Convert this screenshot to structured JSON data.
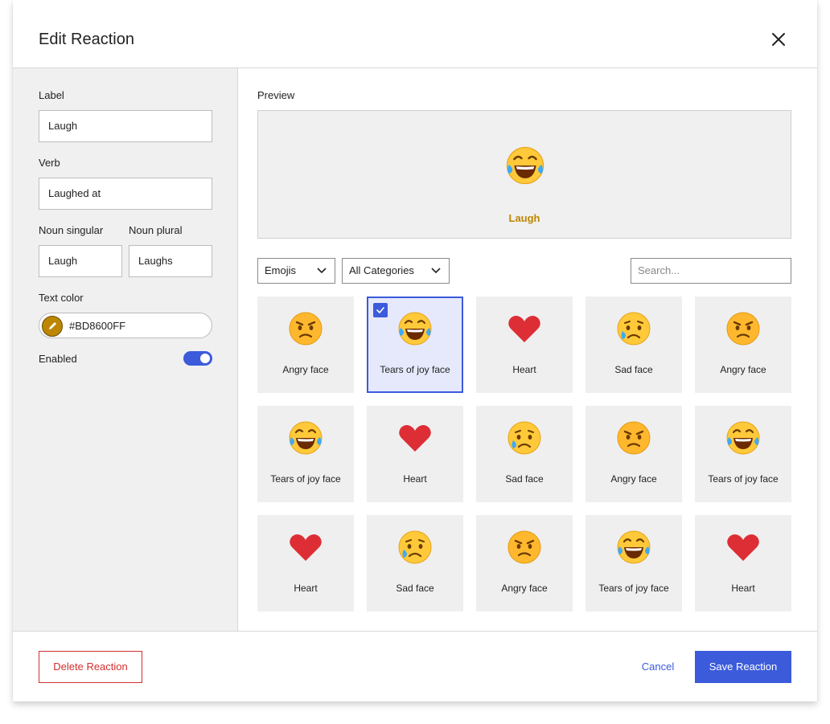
{
  "dialog": {
    "title": "Edit Reaction"
  },
  "form": {
    "label": {
      "label": "Label",
      "value": "Laugh"
    },
    "verb": {
      "label": "Verb",
      "value": "Laughed at"
    },
    "noun_singular": {
      "label": "Noun singular",
      "value": "Laugh"
    },
    "noun_plural": {
      "label": "Noun plural",
      "value": "Laughs"
    },
    "text_color": {
      "label": "Text color",
      "value": "#BD8600FF",
      "color": "#BD8600"
    },
    "enabled": {
      "label": "Enabled",
      "on": true
    }
  },
  "preview": {
    "heading": "Preview",
    "emoji": "tears-of-joy-emoji",
    "label": "Laugh",
    "label_color": "#BD8600"
  },
  "filters": {
    "type_select": "Emojis",
    "category_select": "All Categories",
    "search_placeholder": "Search..."
  },
  "grid": [
    {
      "label": "Angry face",
      "emoji": "angry",
      "selected": false
    },
    {
      "label": "Tears of joy face",
      "emoji": "joy",
      "selected": true
    },
    {
      "label": "Heart",
      "emoji": "heart",
      "selected": false
    },
    {
      "label": "Sad face",
      "emoji": "sad",
      "selected": false
    },
    {
      "label": "Angry face",
      "emoji": "angry",
      "selected": false
    },
    {
      "label": "Tears of joy face",
      "emoji": "joy",
      "selected": false
    },
    {
      "label": "Heart",
      "emoji": "heart",
      "selected": false
    },
    {
      "label": "Sad face",
      "emoji": "sad",
      "selected": false
    },
    {
      "label": "Angry face",
      "emoji": "angry",
      "selected": false
    },
    {
      "label": "Tears of joy face",
      "emoji": "joy",
      "selected": false
    },
    {
      "label": "Heart",
      "emoji": "heart",
      "selected": false
    },
    {
      "label": "Sad face",
      "emoji": "sad",
      "selected": false
    },
    {
      "label": "Angry face",
      "emoji": "angry",
      "selected": false
    },
    {
      "label": "Tears of joy face",
      "emoji": "joy",
      "selected": false
    },
    {
      "label": "Heart",
      "emoji": "heart",
      "selected": false
    }
  ],
  "footer": {
    "delete_label": "Delete Reaction",
    "cancel_label": "Cancel",
    "save_label": "Save Reaction"
  },
  "colors": {
    "accent": "#3b5bdb",
    "danger": "#d32f2f"
  }
}
